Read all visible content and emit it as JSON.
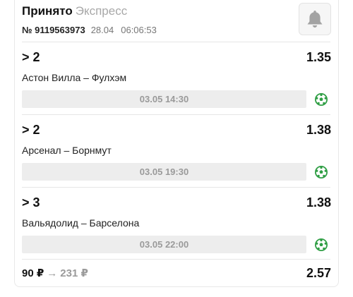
{
  "header": {
    "status": "Принято",
    "bet_type": "Экспресс",
    "bet_number": "№ 9119563973",
    "date": "28.04",
    "time": "06:06:53"
  },
  "events": [
    {
      "outcome": "> 2",
      "odds": "1.35",
      "match": "Астон Вилла – Фулхэм",
      "start": "03.05 14:30",
      "sport_icon": "football-icon"
    },
    {
      "outcome": "> 2",
      "odds": "1.38",
      "match": "Арсенал – Борнмут",
      "start": "03.05 19:30",
      "sport_icon": "football-icon"
    },
    {
      "outcome": "> 3",
      "odds": "1.38",
      "match": "Вальядолид – Барселона",
      "start": "03.05 22:00",
      "sport_icon": "football-icon"
    }
  ],
  "footer": {
    "stake": "90 ₽",
    "arrow": "→",
    "payout": "231 ₽",
    "total_odds": "2.57"
  },
  "colors": {
    "accent_green": "#2f9e44",
    "muted_text": "#9a9a9a",
    "bar_bg": "#ededed"
  },
  "icons": {
    "bell": "bell-icon"
  }
}
